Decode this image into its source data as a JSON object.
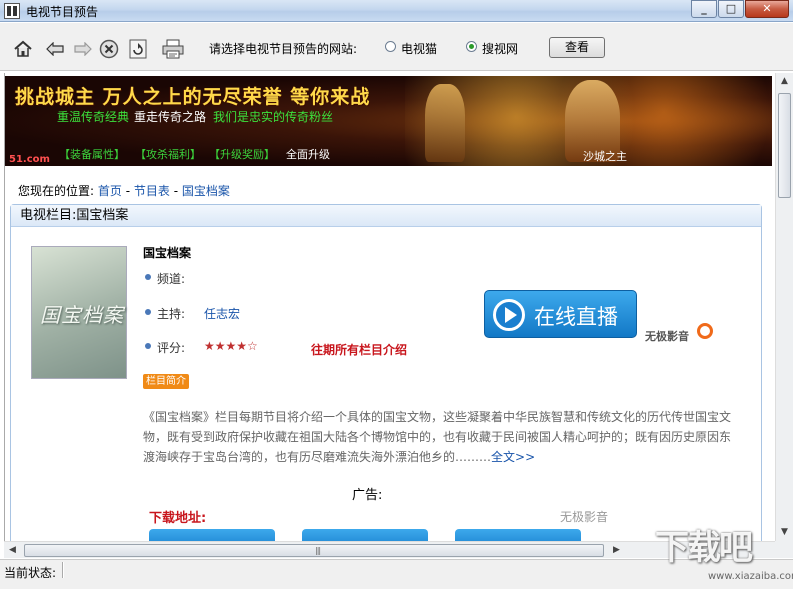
{
  "window": {
    "title": "电视节目预告",
    "minimize_icon": "minimize-icon",
    "maximize_icon": "maximize-icon",
    "close_icon": "close-icon"
  },
  "toolbar": {
    "icons": [
      "home-icon",
      "back-arrow-icon",
      "forward-arrow-icon",
      "stop-icon",
      "refresh-icon",
      "print-icon"
    ],
    "site_prompt": "请选择电视节目预告的网站:",
    "options": [
      {
        "label": "电视猫",
        "selected": false
      },
      {
        "label": "搜视网",
        "selected": true
      }
    ],
    "view_button": "查看"
  },
  "banner": {
    "headline": "挑战城主 万人之上的无尽荣誉 等你来战",
    "sub1": "重温传奇经典",
    "sub2": "重走传奇之路",
    "sub3": "我们是忠实的传奇粉丝",
    "site": "51.com",
    "bottom1": "【装备属性】",
    "bottom2": "【攻杀福利】",
    "bottom3": "【升级奖励】",
    "bottom4": "全面升级",
    "tag": "沙城之主"
  },
  "breadcrumb": {
    "prefix": "您现在的位置:",
    "home": "首页",
    "sep1": " - ",
    "schedule": "节目表",
    "sep2": " - ",
    "current": "国宝档案"
  },
  "panel": {
    "header": "电视栏目:国宝档案",
    "poster_text": "国宝档案",
    "program_title": "国宝档案",
    "channel_label": "频道:",
    "host_label": "主持:",
    "host_name": "任志宏",
    "rating_label": "评分:",
    "rating": 4,
    "rating_max": 5,
    "rating_stars": "★★★★☆",
    "past_link": "往期所有栏目介绍",
    "intro_tag": "栏目简介",
    "live_button": "在线直播",
    "player_brand": "无极影音",
    "description": "《国宝档案》栏目每期节目将介绍一个具体的国宝文物，这些凝聚着中华民族智慧和传统文化的历代传世国宝文物，既有受到政府保护收藏在祖国大陆各个博物馆中的，也有收藏于民间被国人精心呵护的；既有因历史原因东渡海峡存于宝岛台湾的，也有历尽磨难流失海外漂泊他乡的………",
    "more_link": "全文>>",
    "ad_label": "广告:",
    "download_label": "下载地址:",
    "download_source": "无极影音"
  },
  "status": {
    "label": "当前状态:"
  },
  "watermark": {
    "text": "下载吧",
    "sub": "www.xiazaiba.com"
  },
  "colors": {
    "accent_blue": "#1a55aa",
    "link_red": "#c8161d",
    "live_button": "#1a80cf",
    "intro_tag": "#f08a16"
  }
}
